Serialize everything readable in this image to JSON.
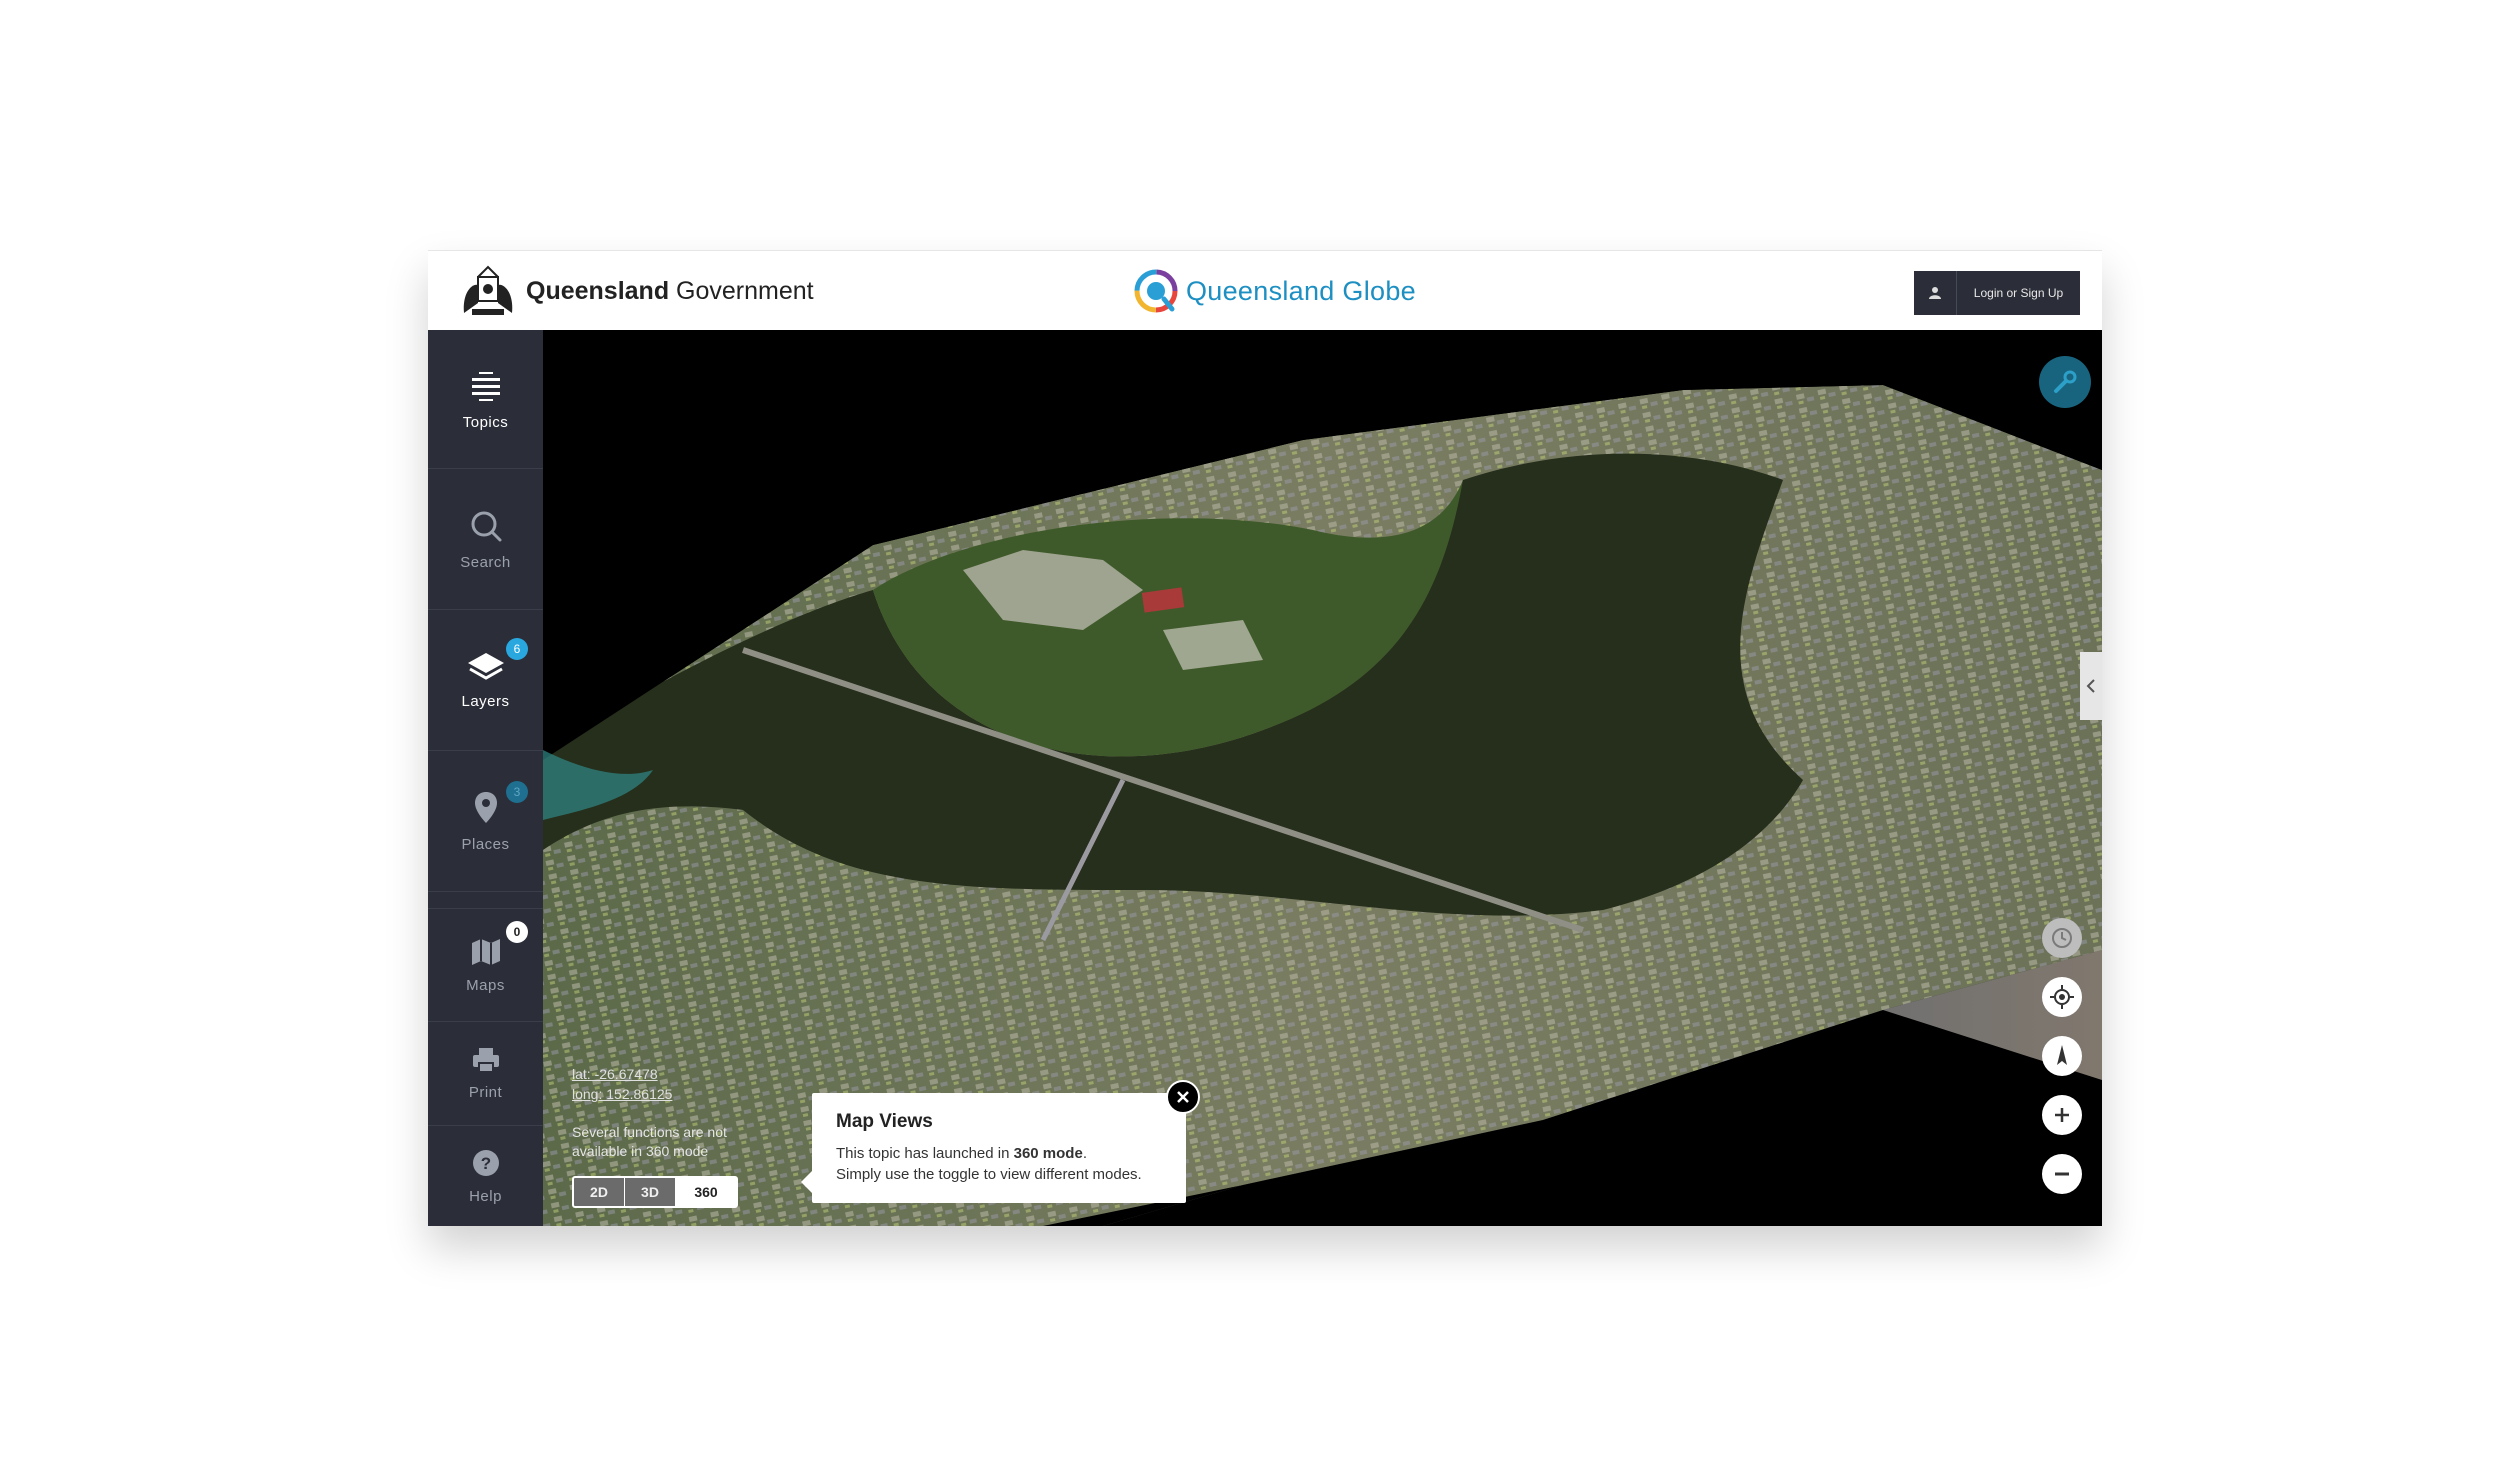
{
  "header": {
    "gov_bold": "Queensland",
    "gov_light": "Government",
    "app_title": "Queensland Globe",
    "login_label": "Login or Sign Up"
  },
  "sidebar": {
    "items": [
      {
        "label": "Topics",
        "icon": "topics-icon"
      },
      {
        "label": "Search",
        "icon": "search-icon"
      },
      {
        "label": "Layers",
        "icon": "layers-icon",
        "badge": "6"
      },
      {
        "label": "Places",
        "icon": "pin-icon",
        "badge": "3"
      },
      {
        "label": "Maps",
        "icon": "map-icon",
        "badge": "0"
      },
      {
        "label": "Print",
        "icon": "print-icon"
      },
      {
        "label": "Help",
        "icon": "help-icon"
      }
    ]
  },
  "map": {
    "lat": "lat: -26.67478",
    "long": "long: 152.86125",
    "warning": "Several functions are not available in 360 mode",
    "modes": [
      "2D",
      "3D",
      "360"
    ],
    "active_mode": "360",
    "controls": [
      "clock-icon",
      "locate-icon",
      "compass-icon",
      "zoom-in-icon",
      "zoom-out-icon"
    ]
  },
  "popup": {
    "title": "Map Views",
    "line1_pre": "This topic has launched in ",
    "line1_bold": "360 mode",
    "line1_post": ".",
    "line2": "Simply use the toggle to view different modes."
  },
  "colors": {
    "sidebar_bg": "#2b2e38",
    "accent": "#1d8fc2",
    "badge_blue": "#29a8e0"
  }
}
